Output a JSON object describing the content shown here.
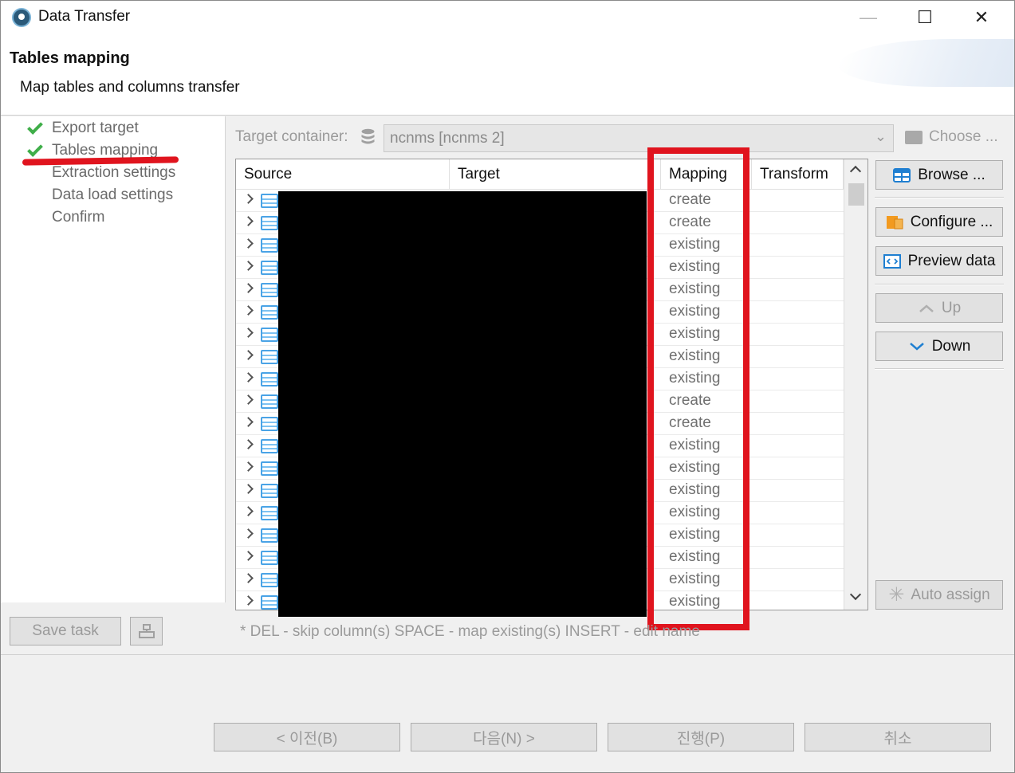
{
  "window": {
    "title": "Data Transfer",
    "min": "—",
    "max": "☐",
    "close": "✕"
  },
  "header": {
    "title": "Tables mapping",
    "subtitle": "Map tables and columns transfer"
  },
  "nav": {
    "items": [
      {
        "label": "Export target",
        "done": true
      },
      {
        "label": "Tables mapping",
        "done": true
      },
      {
        "label": "Extraction settings",
        "done": false
      },
      {
        "label": "Data load settings",
        "done": false
      },
      {
        "label": "Confirm",
        "done": false
      }
    ],
    "save_task": "Save task"
  },
  "target_container": {
    "label": "Target container:",
    "value": "ncnms  [ncnms 2]",
    "choose_label": "Choose ..."
  },
  "table": {
    "columns": [
      "Source",
      "Target",
      "Mapping",
      "Transform"
    ],
    "rows": [
      "create",
      "create",
      "existing",
      "existing",
      "existing",
      "existing",
      "existing",
      "existing",
      "existing",
      "create",
      "create",
      "existing",
      "existing",
      "existing",
      "existing",
      "existing",
      "existing",
      "existing",
      "existing"
    ]
  },
  "side_buttons": {
    "browse": "Browse ...",
    "configure": "Configure ...",
    "preview": "Preview data",
    "up": "Up",
    "down": "Down",
    "auto_assign": "Auto assign"
  },
  "hint": "* DEL - skip column(s)  SPACE - map existing(s)  INSERT - edit name",
  "footer": {
    "back": "< 이전(B)",
    "next": "다음(N) >",
    "proceed": "진행(P)",
    "cancel": "취소"
  },
  "colors": {
    "highlight": "#e0141e",
    "check": "#3fae49",
    "table_icon": "#4aa3e6"
  }
}
